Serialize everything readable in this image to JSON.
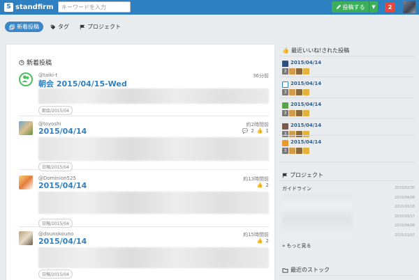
{
  "header": {
    "brand": "standfirm",
    "search_placeholder": "キーワードを入力",
    "post_button": "投稿する",
    "notification_count": "2"
  },
  "nav": {
    "tabs": [
      {
        "label": "新着投稿",
        "active": true
      },
      {
        "label": "タグ",
        "active": false
      },
      {
        "label": "プロジェクト",
        "active": false
      }
    ]
  },
  "main": {
    "title": "新着投稿",
    "posts": [
      {
        "author": "@taiki-t",
        "title": "朝会 2015/04/15-Wed",
        "time": "36分前",
        "comments": "",
        "likes": "",
        "tag": "朝会/2015/04"
      },
      {
        "author": "@toyoshi",
        "title": "2015/04/14",
        "time": "約2時間前",
        "comments": "2",
        "likes": "1",
        "tag": "日報/2015/04"
      },
      {
        "author": "@Dominion525",
        "title": "2015/04/14",
        "time": "約13時間前",
        "comments": "",
        "likes": "2",
        "tag": "日報/2015/04"
      },
      {
        "author": "@dounokouno",
        "title": "2015/04/14",
        "time": "約15時間前",
        "comments": "",
        "likes": "2",
        "tag": "日報/2015/04"
      }
    ]
  },
  "sidebar": {
    "liked_title": "最近いいね!された投稿",
    "liked": [
      {
        "date": "2015/04/14",
        "count": "3"
      },
      {
        "date": "2015/04/14",
        "count": "3"
      },
      {
        "date": "2015/04/14",
        "count": "3"
      },
      {
        "date": "2015/04/14",
        "count": "3"
      },
      {
        "date": "2015/04/14",
        "count": "3"
      }
    ],
    "projects_title": "プロジェクト",
    "project_first": "ガイドライン",
    "project_dates": [
      "2015/03/30",
      "2015/04/08",
      "2015/03/18",
      "2015/03/17",
      "2015/04/08",
      "2015/01/07"
    ],
    "more_label": "もっと見る",
    "stock_title": "最近のストック"
  },
  "colors": {
    "header": "#2f80c0",
    "post_button": "#3dae5a",
    "notification": "#e8483b",
    "link": "#2f80c0"
  }
}
